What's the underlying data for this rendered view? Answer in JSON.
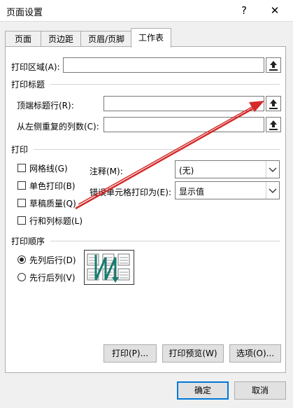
{
  "dialog": {
    "title": "页面设置",
    "help_label": "?",
    "close_label": "✕"
  },
  "tabs": [
    {
      "label": "页面",
      "active": false
    },
    {
      "label": "页边距",
      "active": false
    },
    {
      "label": "页眉/页脚",
      "active": false
    },
    {
      "label": "工作表",
      "active": true
    }
  ],
  "print_area": {
    "label": "打印区域(A):",
    "value": ""
  },
  "print_titles": {
    "section": "打印标题",
    "rows_label": "顶端标题行(R):",
    "rows_value": "",
    "cols_label": "从左侧重复的列数(C):",
    "cols_value": ""
  },
  "print": {
    "section": "打印",
    "options": [
      {
        "label": "网格线(G)",
        "checked": false
      },
      {
        "label": "单色打印(B)",
        "checked": false
      },
      {
        "label": "草稿质量(Q)",
        "checked": false
      },
      {
        "label": "行和列标题(L)",
        "checked": false
      }
    ],
    "comments_label": "注释(M):",
    "comments_value": "(无)",
    "errors_label": "错误单元格打印为(E):",
    "errors_value": "显示值"
  },
  "page_order": {
    "section": "打印顺序",
    "options": [
      {
        "label": "先列后行(D)",
        "selected": true
      },
      {
        "label": "先行后列(V)",
        "selected": false
      }
    ]
  },
  "buttons": {
    "print": "打印(P)...",
    "preview": "打印预览(W)",
    "options": "选项(O)...",
    "ok": "确定",
    "cancel": "取消"
  },
  "colors": {
    "accent": "#0078d7",
    "annotation_arrow": "#d42a2a",
    "order_arrow": "#1a7a70"
  }
}
